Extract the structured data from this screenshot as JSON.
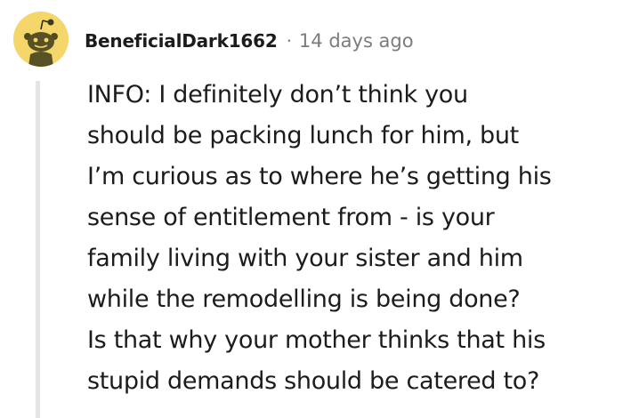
{
  "comment": {
    "username": "BeneficialDark1662",
    "separator": "·",
    "timestamp": "14 days ago",
    "avatar_icon": "snoo-avatar-icon",
    "avatar_color": "#f5d66a",
    "body_lines": [
      "INFO: I definitely don’t think you",
      "should be packing lunch for him, but",
      "I’m curious as to where he’s getting his",
      "sense of entitlement from - is your",
      "family living with your sister and him",
      "while the remodelling is being done?",
      "Is that why your mother thinks that his",
      "stupid demands should be catered to?"
    ]
  }
}
